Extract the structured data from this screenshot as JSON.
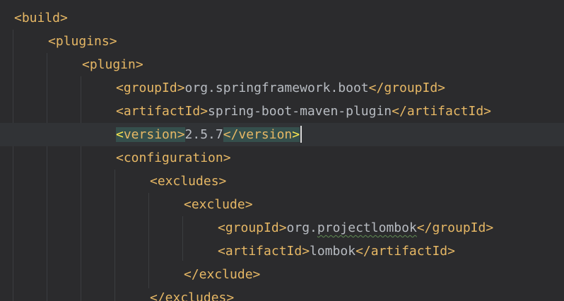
{
  "editor": {
    "lines": [
      {
        "open": "<build>"
      },
      {
        "open": "<plugins>"
      },
      {
        "open": "<plugin>"
      },
      {
        "open": "<groupId>",
        "value": "org.springframework.boot",
        "close": "</groupId>"
      },
      {
        "open": "<artifactId>",
        "value": "spring-boot-maven-plugin",
        "close": "</artifactId>"
      },
      {
        "open_bracket": "<",
        "open_name": "version>",
        "value": "2.5.7",
        "close_name": "</version",
        "close_bracket": ">"
      },
      {
        "open": "<configuration>"
      },
      {
        "open": "<excludes>"
      },
      {
        "open": "<exclude>"
      },
      {
        "open": "<groupId>",
        "value_prefix": "org.",
        "value_warn": "projectlombok",
        "close": "</groupId>"
      },
      {
        "open": "<artifactId>",
        "value": "lombok",
        "close": "</artifactId>"
      },
      {
        "open": "</exclude>"
      },
      {
        "open": "</excludes>"
      }
    ],
    "colors": {
      "background": "#2b2b2d",
      "tag": "#e7b865",
      "text": "#b8bcc2",
      "brace_match": "#354f4c",
      "current_line": "#313336"
    }
  }
}
